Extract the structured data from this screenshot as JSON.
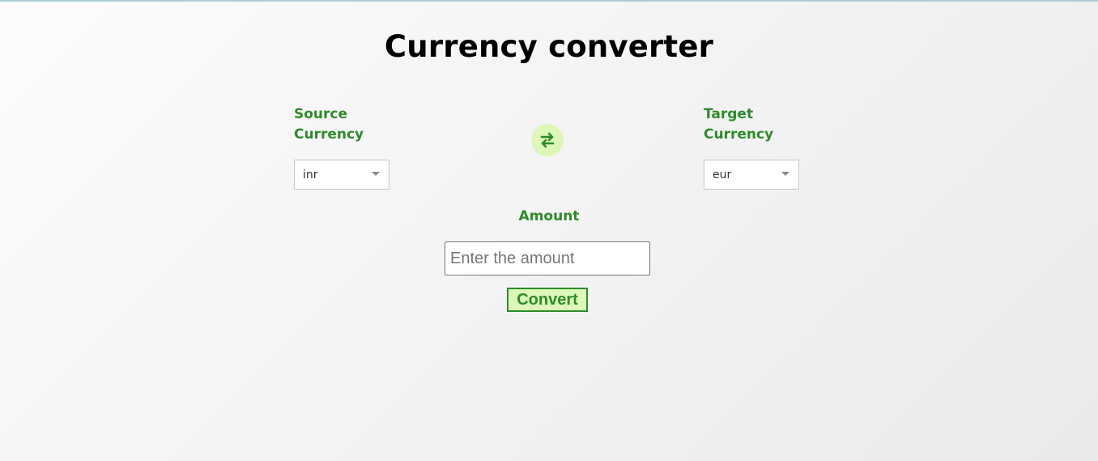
{
  "page": {
    "title": "Currency converter"
  },
  "converter": {
    "source": {
      "label": "Source Currency",
      "selected_value": "inr"
    },
    "target": {
      "label": "Target Currency",
      "selected_value": "eur"
    },
    "swap": {
      "icon": "swap-arrows-icon"
    },
    "amount": {
      "label": "Amount",
      "placeholder": "Enter the amount",
      "value": ""
    },
    "convert_label": "Convert"
  },
  "colors": {
    "accent": "#2e8b2a",
    "accent_background": "#dcf7b8",
    "title": "#000000"
  }
}
